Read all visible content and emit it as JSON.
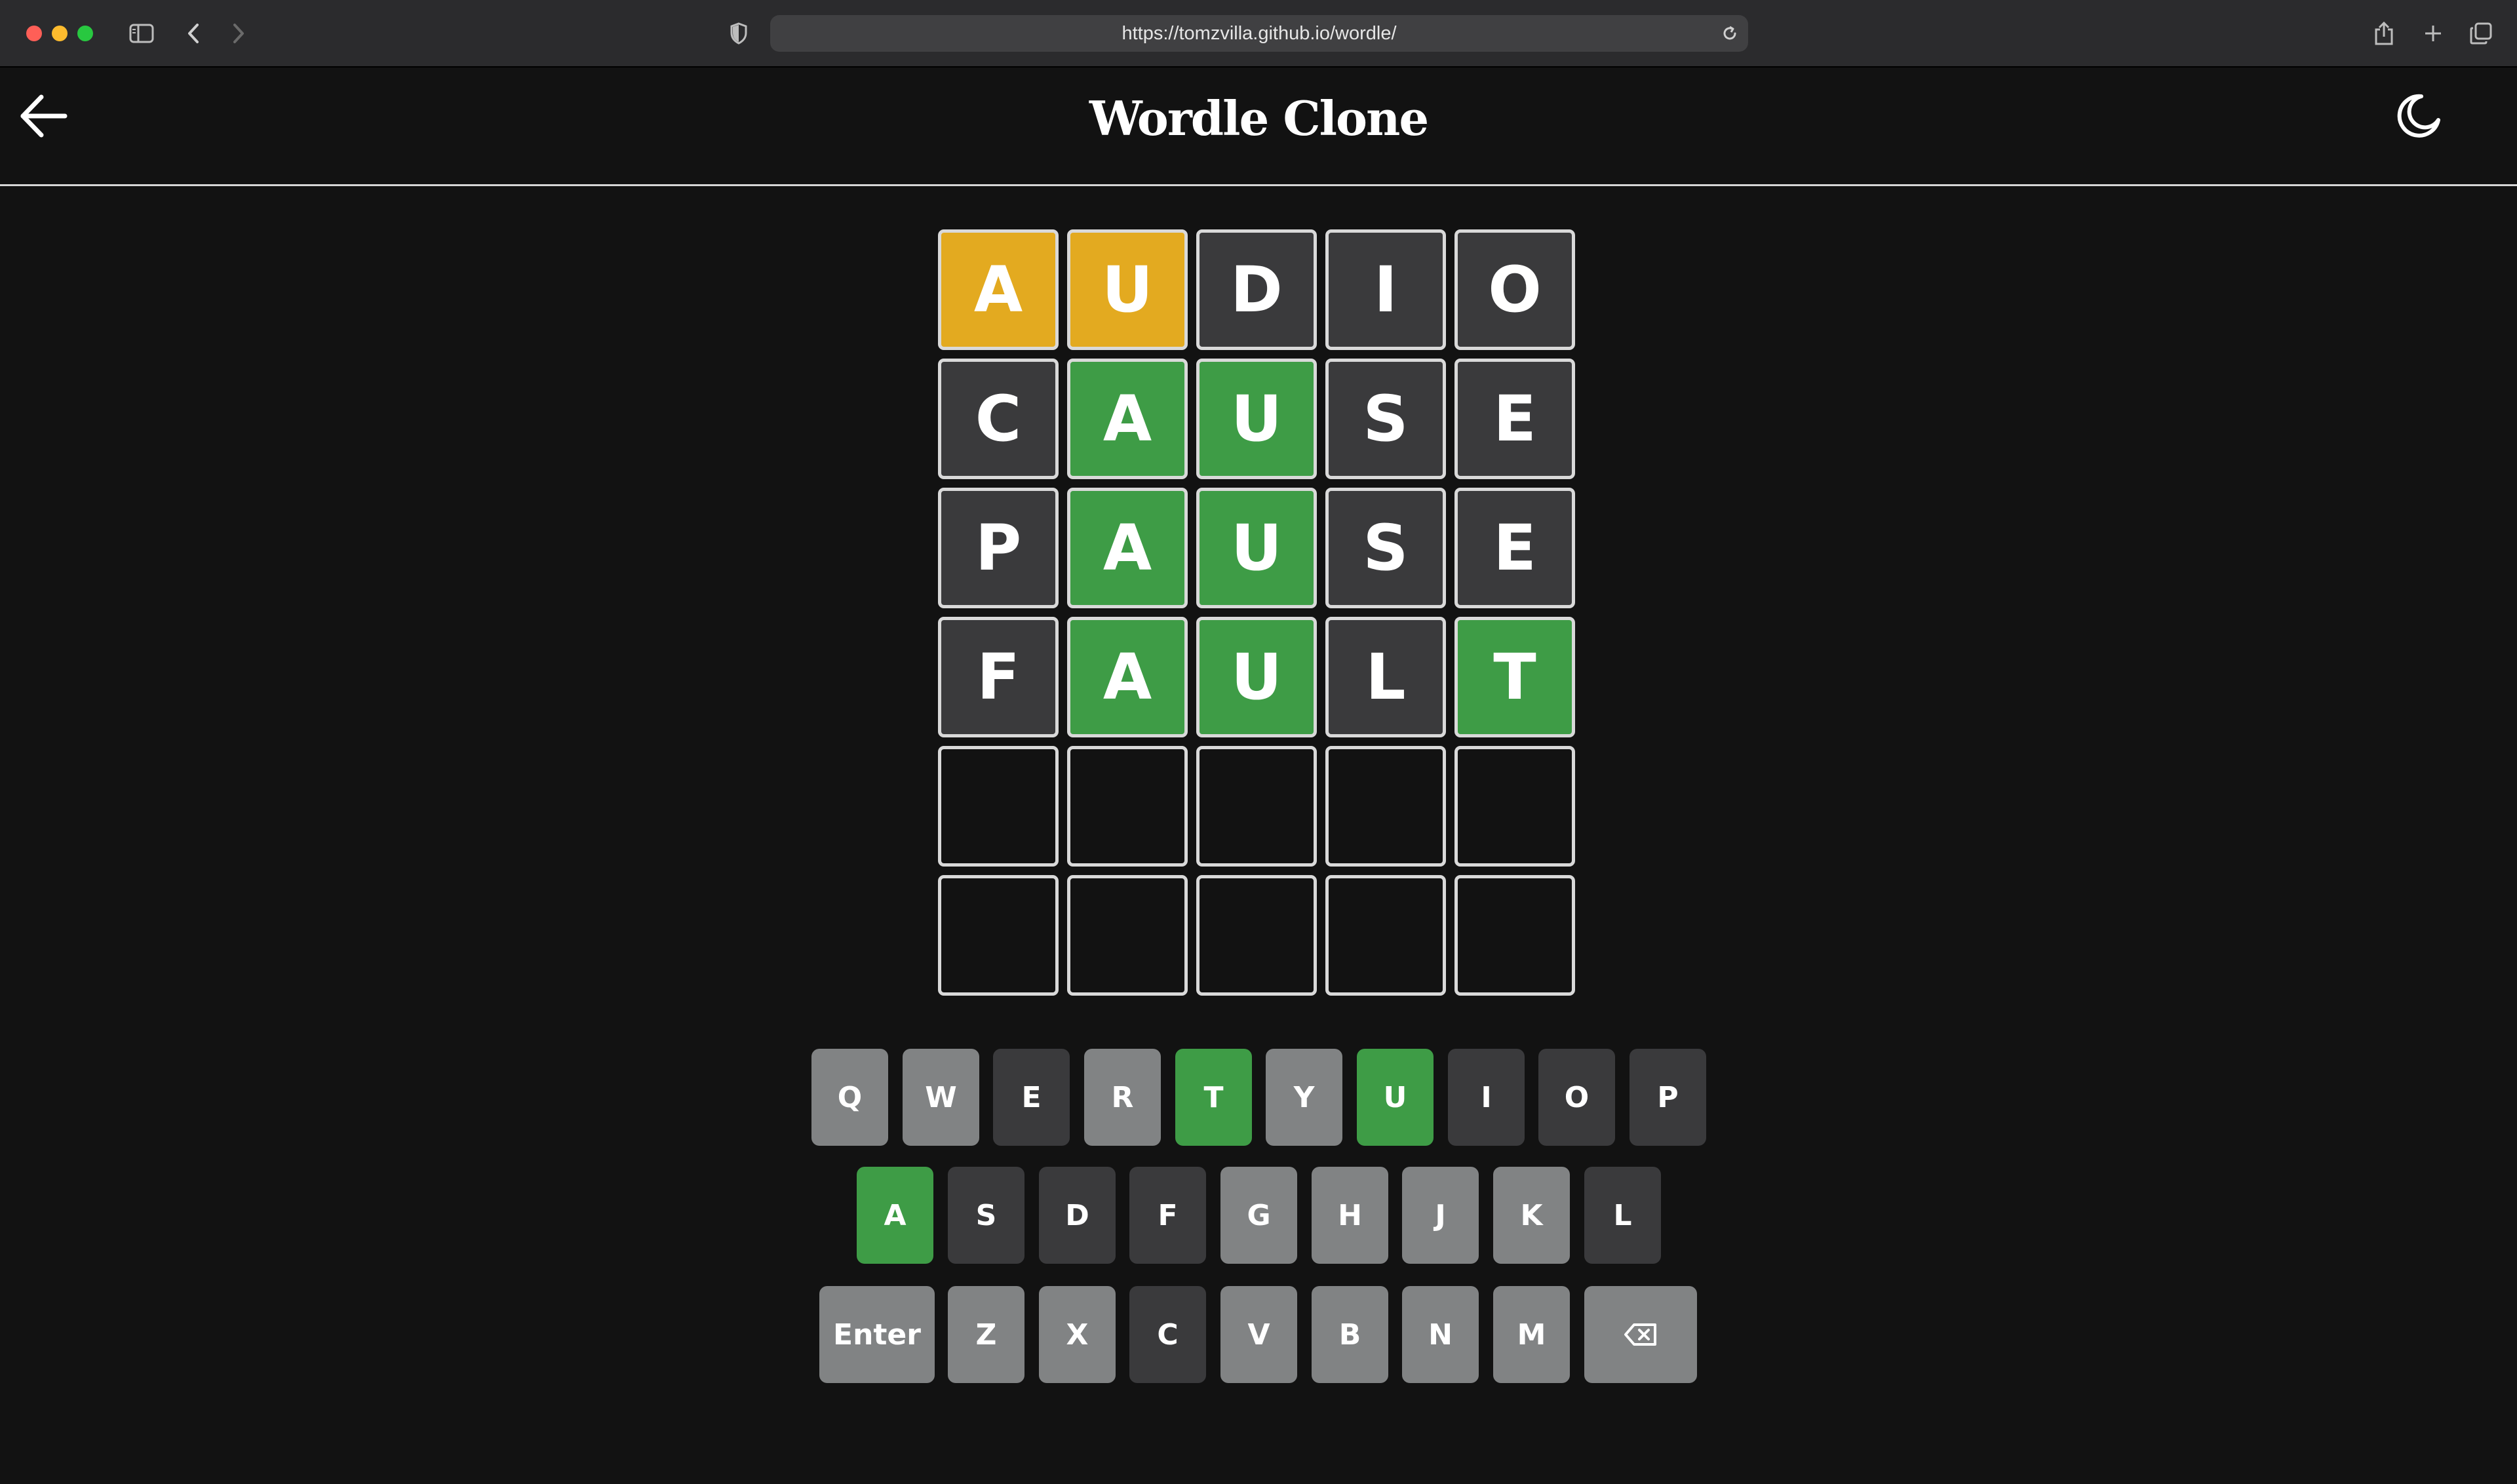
{
  "browser": {
    "url": "https://tomzvilla.github.io/wordle/"
  },
  "app": {
    "title": "Wordle Clone"
  },
  "colors": {
    "correct": "#3e9c46",
    "present": "#e3aa20",
    "absent": "#3a3a3c",
    "unused": "#818384",
    "background": "#121212"
  },
  "board": [
    [
      {
        "letter": "A",
        "state": "present"
      },
      {
        "letter": "U",
        "state": "present"
      },
      {
        "letter": "D",
        "state": "absent"
      },
      {
        "letter": "I",
        "state": "absent"
      },
      {
        "letter": "O",
        "state": "absent"
      }
    ],
    [
      {
        "letter": "C",
        "state": "absent"
      },
      {
        "letter": "A",
        "state": "correct"
      },
      {
        "letter": "U",
        "state": "correct"
      },
      {
        "letter": "S",
        "state": "absent"
      },
      {
        "letter": "E",
        "state": "absent"
      }
    ],
    [
      {
        "letter": "P",
        "state": "absent"
      },
      {
        "letter": "A",
        "state": "correct"
      },
      {
        "letter": "U",
        "state": "correct"
      },
      {
        "letter": "S",
        "state": "absent"
      },
      {
        "letter": "E",
        "state": "absent"
      }
    ],
    [
      {
        "letter": "F",
        "state": "absent"
      },
      {
        "letter": "A",
        "state": "correct"
      },
      {
        "letter": "U",
        "state": "correct"
      },
      {
        "letter": "L",
        "state": "absent"
      },
      {
        "letter": "T",
        "state": "correct"
      }
    ],
    [
      {
        "letter": "",
        "state": "empty"
      },
      {
        "letter": "",
        "state": "empty"
      },
      {
        "letter": "",
        "state": "empty"
      },
      {
        "letter": "",
        "state": "empty"
      },
      {
        "letter": "",
        "state": "empty"
      }
    ],
    [
      {
        "letter": "",
        "state": "empty"
      },
      {
        "letter": "",
        "state": "empty"
      },
      {
        "letter": "",
        "state": "empty"
      },
      {
        "letter": "",
        "state": "empty"
      },
      {
        "letter": "",
        "state": "empty"
      }
    ]
  ],
  "keyboard": {
    "row1": [
      {
        "label": "Q",
        "state": "unused"
      },
      {
        "label": "W",
        "state": "unused"
      },
      {
        "label": "E",
        "state": "absent"
      },
      {
        "label": "R",
        "state": "unused"
      },
      {
        "label": "T",
        "state": "correct"
      },
      {
        "label": "Y",
        "state": "unused"
      },
      {
        "label": "U",
        "state": "correct"
      },
      {
        "label": "I",
        "state": "absent"
      },
      {
        "label": "O",
        "state": "absent"
      },
      {
        "label": "P",
        "state": "absent"
      }
    ],
    "row2": [
      {
        "label": "A",
        "state": "correct"
      },
      {
        "label": "S",
        "state": "absent"
      },
      {
        "label": "D",
        "state": "absent"
      },
      {
        "label": "F",
        "state": "absent"
      },
      {
        "label": "G",
        "state": "unused"
      },
      {
        "label": "H",
        "state": "unused"
      },
      {
        "label": "J",
        "state": "unused"
      },
      {
        "label": "K",
        "state": "unused"
      },
      {
        "label": "L",
        "state": "absent"
      }
    ],
    "row3": [
      {
        "label": "Enter",
        "state": "unused"
      },
      {
        "label": "Z",
        "state": "unused"
      },
      {
        "label": "X",
        "state": "unused"
      },
      {
        "label": "C",
        "state": "absent"
      },
      {
        "label": "V",
        "state": "unused"
      },
      {
        "label": "B",
        "state": "unused"
      },
      {
        "label": "N",
        "state": "unused"
      },
      {
        "label": "M",
        "state": "unused"
      },
      {
        "label": "",
        "state": "unused",
        "icon": "backspace-icon"
      }
    ]
  }
}
